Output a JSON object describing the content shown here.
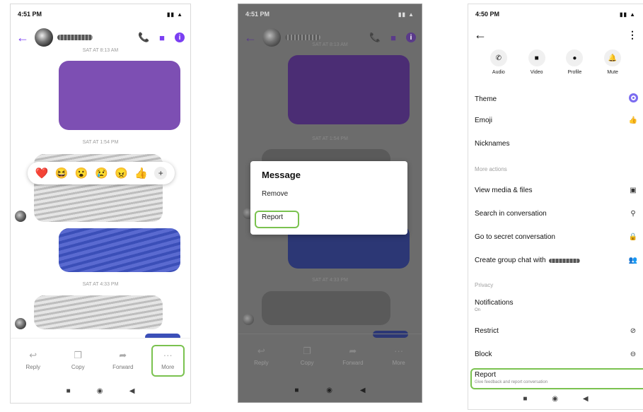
{
  "phone1": {
    "status_time": "4:51 PM",
    "timestamps": [
      "SAT AT 8:13 AM",
      "SAT AT 1:54 PM",
      "SAT AT 4:33 PM"
    ],
    "reactions": [
      "❤️",
      "😆",
      "😮",
      "😢",
      "😠",
      "👍",
      "+"
    ],
    "toolbar": [
      {
        "label": "Reply",
        "icon": "reply-icon"
      },
      {
        "label": "Copy",
        "icon": "copy-icon"
      },
      {
        "label": "Forward",
        "icon": "forward-icon"
      },
      {
        "label": "More",
        "icon": "more-icon"
      }
    ]
  },
  "phone2": {
    "status_time": "4:51 PM",
    "timestamps": [
      "SAT AT 8:13 AM",
      "SAT AT 1:54 PM",
      "SAT AT 4:33 PM"
    ],
    "dialog": {
      "title": "Message",
      "remove": "Remove",
      "report": "Report"
    },
    "toolbar": [
      {
        "label": "Reply"
      },
      {
        "label": "Copy"
      },
      {
        "label": "Forward"
      },
      {
        "label": "More"
      }
    ]
  },
  "phone3": {
    "status_time": "4:50 PM",
    "quick_actions": [
      {
        "label": "Audio",
        "icon": "phone-icon"
      },
      {
        "label": "Video",
        "icon": "video-icon"
      },
      {
        "label": "Profile",
        "icon": "profile-icon"
      },
      {
        "label": "Mute",
        "icon": "bell-icon"
      }
    ],
    "theme": "Theme",
    "emoji": "Emoji",
    "nicknames": "Nicknames",
    "more_actions_header": "More actions",
    "view_media": "View media & files",
    "search": "Search in conversation",
    "secret": "Go to secret conversation",
    "group": "Create group chat with",
    "privacy_header": "Privacy",
    "notifications": "Notifications",
    "notifications_sub": "On",
    "restrict": "Restrict",
    "block": "Block",
    "report": "Report",
    "report_sub": "Give feedback and report conversation"
  },
  "colors": {
    "accent": "#7b3ff2",
    "highlight": "#7ac24f",
    "purple_bubble": "#7d4fb3",
    "blue_bubble": "#3b4fb8"
  }
}
